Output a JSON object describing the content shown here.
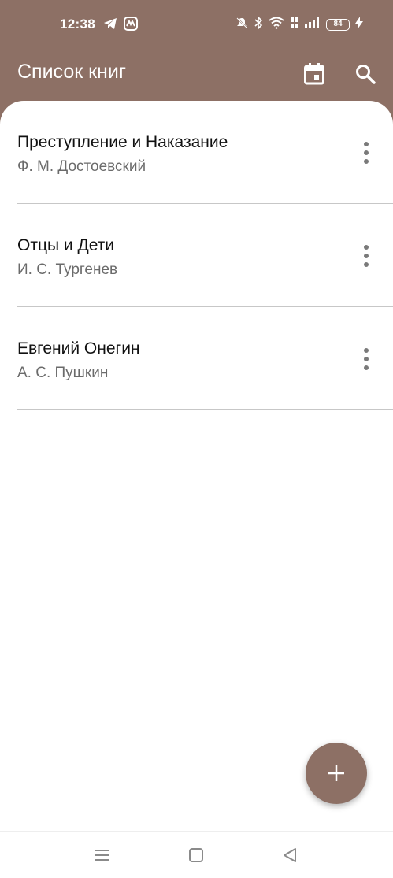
{
  "status_bar": {
    "time": "12:38",
    "battery": "84",
    "left_icons": [
      "telegram-icon",
      "app-notification-icon"
    ],
    "right_icons": [
      "mute-icon",
      "bluetooth-icon",
      "wifi-icon",
      "volte-icon",
      "signal-icon",
      "battery-icon",
      "charging-icon"
    ]
  },
  "app_bar": {
    "title": "Список книг",
    "actions": [
      "calendar-icon",
      "search-icon"
    ]
  },
  "books": [
    {
      "title": "Преступление и Наказание",
      "author": "Ф. М. Достоевский"
    },
    {
      "title": "Отцы и Дети",
      "author": "И. С. Тургенев"
    },
    {
      "title": "Евгений Онегин",
      "author": "А. С. Пушкин"
    }
  ],
  "fab": {
    "icon": "plus-icon"
  },
  "colors": {
    "primary": "#8d7065",
    "surface": "#ffffff",
    "title_text": "#111111",
    "subtitle_text": "#6b6b6b",
    "divider": "#c7c7c7"
  }
}
